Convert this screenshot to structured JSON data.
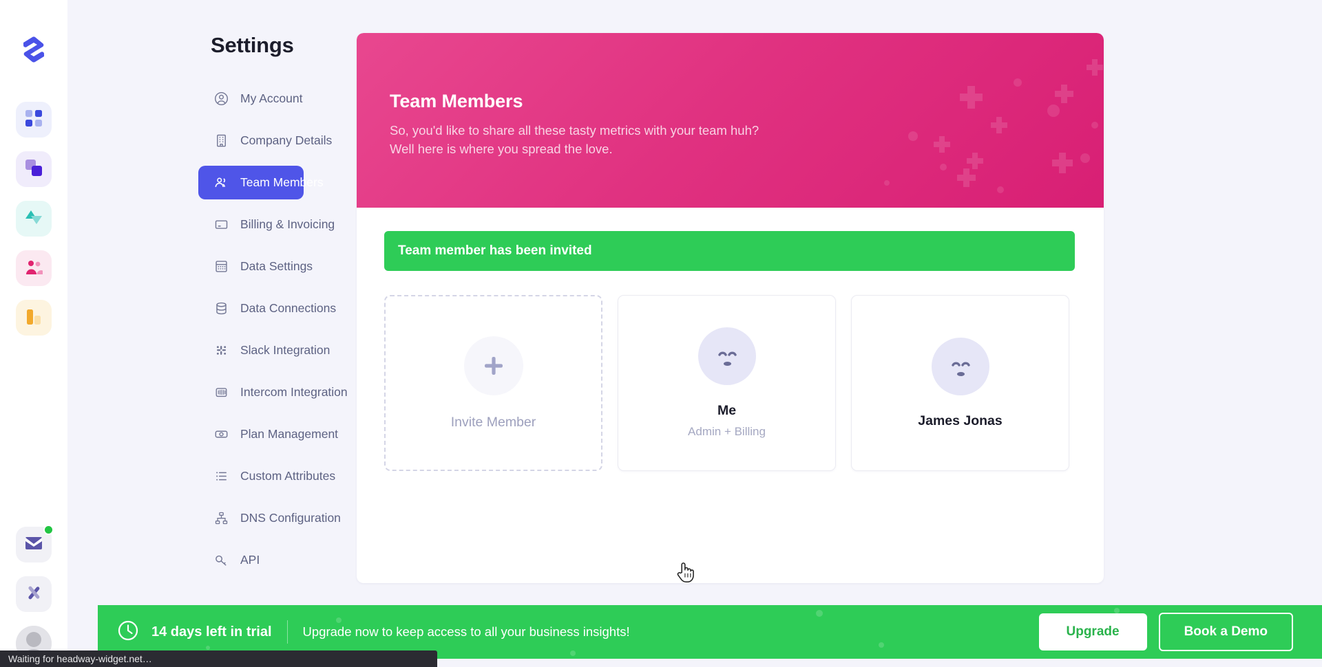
{
  "rail": {
    "logo_name": "app-logo",
    "items": [
      {
        "name": "dashboard-icon",
        "label": "Dashboard"
      },
      {
        "name": "layers-icon",
        "label": "Boards"
      },
      {
        "name": "triangles-icon",
        "label": "Goals"
      },
      {
        "name": "people-icon",
        "label": "Customers"
      },
      {
        "name": "bar-chart-icon",
        "label": "Reports"
      }
    ],
    "bottom": [
      {
        "name": "mail-icon",
        "label": "Inbox",
        "badge": true
      },
      {
        "name": "close-icon",
        "label": "Close"
      },
      {
        "name": "avatar",
        "label": "Profile"
      }
    ]
  },
  "settings": {
    "title": "Settings",
    "items": [
      {
        "label": "My Account",
        "icon": "user-circle-icon",
        "active": false
      },
      {
        "label": "Company Details",
        "icon": "building-icon",
        "active": false
      },
      {
        "label": "Team Members",
        "icon": "team-icon",
        "active": true
      },
      {
        "label": "Billing & Invoicing",
        "icon": "card-icon",
        "active": false
      },
      {
        "label": "Data Settings",
        "icon": "grid-table-icon",
        "active": false
      },
      {
        "label": "Data Connections",
        "icon": "database-icon",
        "active": false
      },
      {
        "label": "Slack Integration",
        "icon": "slack-icon",
        "active": false
      },
      {
        "label": "Intercom Integration",
        "icon": "intercom-icon",
        "active": false
      },
      {
        "label": "Plan Management",
        "icon": "banknote-icon",
        "active": false
      },
      {
        "label": "Custom Attributes",
        "icon": "list-icon",
        "active": false
      },
      {
        "label": "DNS Configuration",
        "icon": "sitemap-icon",
        "active": false
      },
      {
        "label": "API",
        "icon": "key-icon",
        "active": false
      }
    ]
  },
  "hero": {
    "title": "Team Members",
    "line1": "So, you'd like to share all these tasty metrics with your team huh?",
    "line2": "Well here is where you spread the love.",
    "color_from": "#e8478f",
    "color_to": "#d81f74"
  },
  "alert": {
    "message": "Team member has been invited",
    "color": "#2ecc57"
  },
  "members": {
    "invite": {
      "label": "Invite Member",
      "icon": "plus-icon"
    },
    "cards": [
      {
        "name": "Me",
        "role": "Admin + Billing",
        "avatar": "smiley-avatar"
      },
      {
        "name": "James Jonas",
        "role": "",
        "avatar": "smiley-avatar"
      }
    ]
  },
  "trial": {
    "icon": "clock-icon",
    "days_text": "14 days left in trial",
    "message": "Upgrade now to keep access to all your business insights!",
    "upgrade_label": "Upgrade",
    "demo_label": "Book a Demo",
    "color": "#2ecc57"
  },
  "statusbar": {
    "text": "Waiting for headway-widget.net…"
  },
  "cursor": {
    "type": "pointer-hand-cursor"
  }
}
